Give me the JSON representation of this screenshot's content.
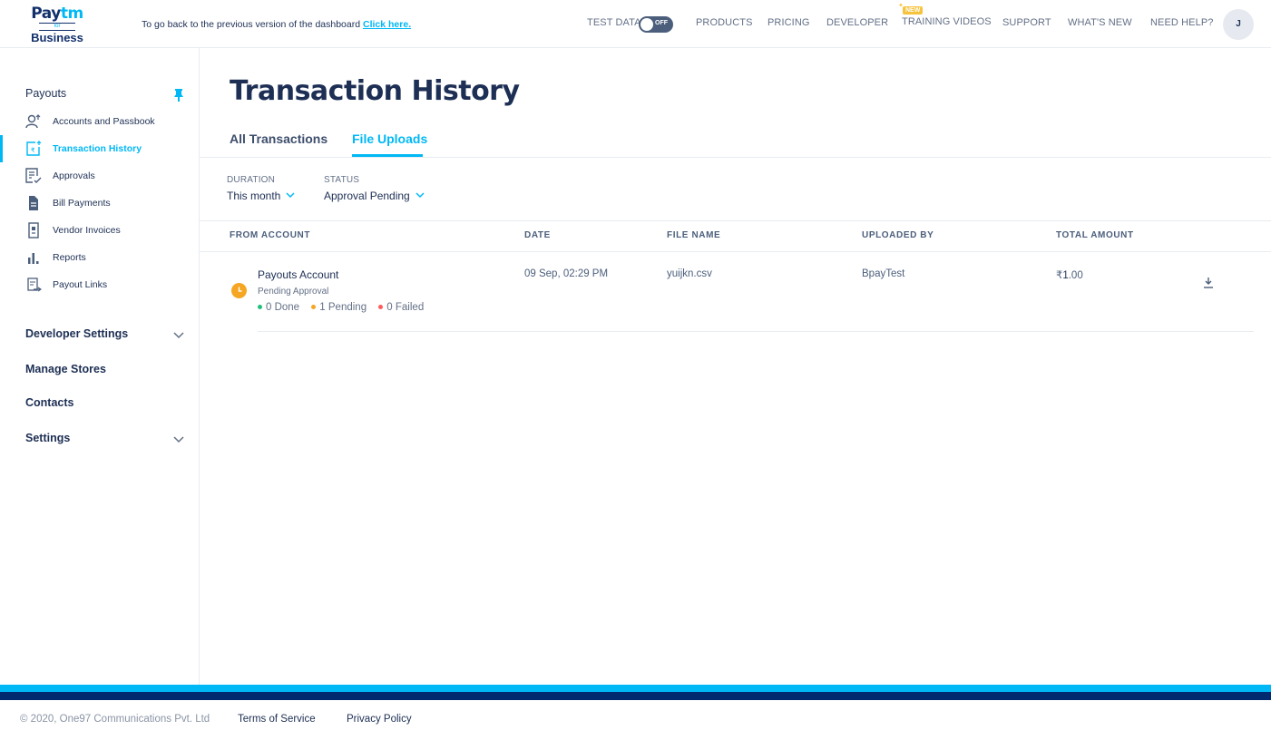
{
  "header": {
    "logo": {
      "line1a": "Pay",
      "line1b": "tm",
      "line2": "for",
      "line3": "Business"
    },
    "back_note": "To go back to the previous version of the dashboard",
    "back_link": "Click here.",
    "test_data_label": "TEST DATA",
    "test_data_toggle": "OFF",
    "nav": {
      "products": "PRODUCTS",
      "pricing": "PRICING",
      "developer": "DEVELOPER",
      "training_videos": "TRAINING VIDEOS",
      "training_badge": "NEW",
      "support": "SUPPORT",
      "whats_new": "WHAT'S NEW",
      "need_help": "NEED HELP?"
    },
    "avatar_initial": "J"
  },
  "sidebar": {
    "title": "Payouts",
    "items": [
      {
        "label": "Accounts and Passbook",
        "icon": "account-icon"
      },
      {
        "label": "Transaction History",
        "icon": "transaction-history-icon",
        "active": true
      },
      {
        "label": "Approvals",
        "icon": "approvals-icon"
      },
      {
        "label": "Bill Payments",
        "icon": "bill-icon"
      },
      {
        "label": "Vendor Invoices",
        "icon": "invoice-icon"
      },
      {
        "label": "Reports",
        "icon": "reports-icon"
      },
      {
        "label": "Payout Links",
        "icon": "payout-link-icon"
      }
    ],
    "sections": {
      "developer_settings": "Developer Settings",
      "manage_stores": "Manage Stores",
      "contacts": "Contacts",
      "settings": "Settings"
    }
  },
  "main": {
    "title": "Transaction History",
    "tabs": {
      "all": "All Transactions",
      "uploads": "File Uploads"
    },
    "filters": {
      "duration_label": "DURATION",
      "duration_value": "This month",
      "status_label": "STATUS",
      "status_value": "Approval Pending"
    },
    "columns": {
      "from_account": "FROM ACCOUNT",
      "date": "DATE",
      "file_name": "FILE NAME",
      "uploaded_by": "UPLOADED BY",
      "total_amount": "TOTAL AMOUNT"
    },
    "row": {
      "account": "Payouts Account",
      "status": "Pending Approval",
      "done": "0 Done",
      "pending": "1 Pending",
      "failed": "0 Failed",
      "date": "09 Sep, 02:29 PM",
      "file_name": "yuijkn.csv",
      "uploaded_by": "BpayTest",
      "amount_symbol": "₹",
      "amount_int": "1",
      "amount_dec": ".00"
    }
  },
  "footer": {
    "copyright": "© 2020, One97 Communications Pvt. Ltd",
    "terms": "Terms of Service",
    "privacy": "Privacy Policy"
  },
  "colors": {
    "accent": "#00b8f5",
    "navy": "#002970",
    "text": "#1d2f54",
    "pending": "#f5a623",
    "done": "#21c17a",
    "failed": "#fd5c5c"
  }
}
